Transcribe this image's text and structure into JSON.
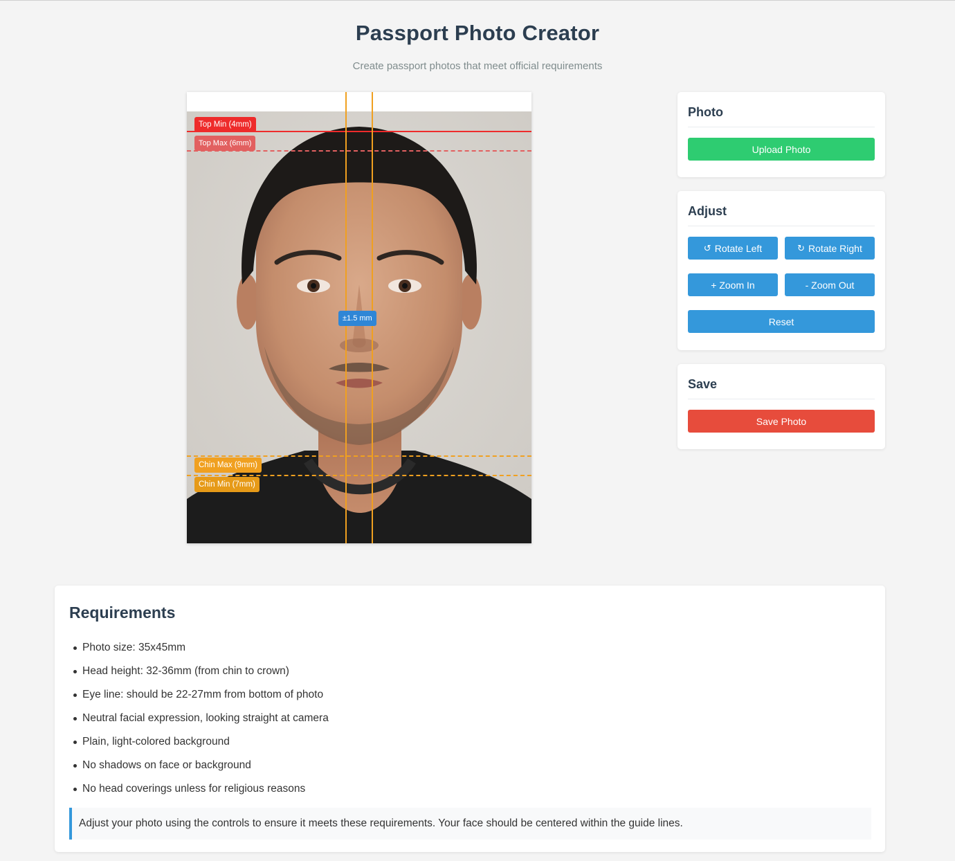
{
  "header": {
    "title": "Passport Photo Creator",
    "subtitle": "Create passport photos that meet official requirements"
  },
  "photo_guides": {
    "top_min_label": "Top Min (4mm)",
    "top_max_label": "Top Max (6mm)",
    "chin_max_label": "Chin Max (9mm)",
    "chin_min_label": "Chin Min (7mm)",
    "center_tolerance_label": "±1.5 mm",
    "colors": {
      "top_min": "#ee2b2b",
      "top_max": "#e26060",
      "chin": "#f0a020",
      "center": "#f0a020",
      "tolerance_badge": "#2f86d6"
    }
  },
  "panels": {
    "photo": {
      "title": "Photo",
      "upload_label": "Upload Photo"
    },
    "adjust": {
      "title": "Adjust",
      "rotate_left_icon": "↺",
      "rotate_left_label": "Rotate Left",
      "rotate_right_icon": "↻",
      "rotate_right_label": "Rotate Right",
      "zoom_in_label": "+ Zoom In",
      "zoom_out_label": "- Zoom Out",
      "reset_label": "Reset"
    },
    "save": {
      "title": "Save",
      "save_label": "Save Photo"
    }
  },
  "requirements": {
    "title": "Requirements",
    "items": [
      "Photo size: 35x45mm",
      "Head height: 32-36mm (from chin to crown)",
      "Eye line: should be 22-27mm from bottom of photo",
      "Neutral facial expression, looking straight at camera",
      "Plain, light-colored background",
      "No shadows on face or background",
      "No head coverings unless for religious reasons"
    ],
    "note": "Adjust your photo using the controls to ensure it meets these requirements. Your face should be centered within the guide lines."
  },
  "colors": {
    "primary": "#3498db",
    "success": "#2ecc71",
    "danger": "#e74c3c",
    "text_dark": "#2c3e50",
    "text_muted": "#7f8c8d"
  }
}
